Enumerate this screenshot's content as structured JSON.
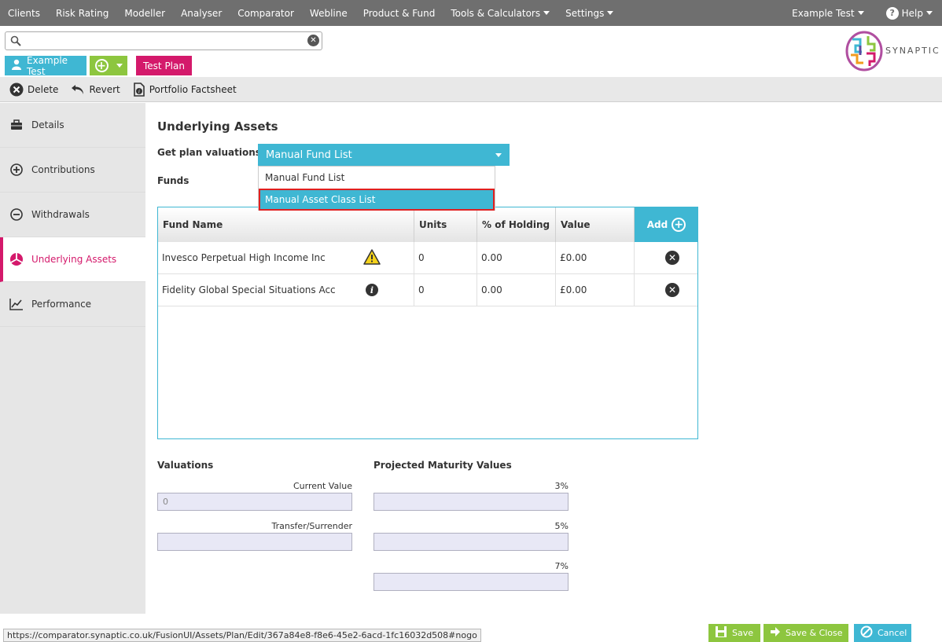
{
  "topnav": {
    "items": [
      "Clients",
      "Risk Rating",
      "Modeller",
      "Analyser",
      "Comparator",
      "Webline",
      "Product & Fund",
      "Tools & Calculators",
      "Settings"
    ],
    "user": "Example Test",
    "help": "Help"
  },
  "search": {
    "value": "",
    "placeholder": ""
  },
  "logo": {
    "text": "SYNAPTIC"
  },
  "client": {
    "name": "Example Test",
    "plan": "Test Plan"
  },
  "toolbar": {
    "delete": "Delete",
    "revert": "Revert",
    "factsheet": "Portfolio Factsheet"
  },
  "sidebar": {
    "items": [
      {
        "label": "Details",
        "icon": "briefcase-icon"
      },
      {
        "label": "Contributions",
        "icon": "plus-circle-icon"
      },
      {
        "label": "Withdrawals",
        "icon": "minus-circle-icon"
      },
      {
        "label": "Underlying Assets",
        "icon": "pie-chart-icon"
      },
      {
        "label": "Performance",
        "icon": "line-chart-icon"
      }
    ],
    "active": "Underlying Assets"
  },
  "main": {
    "title": "Underlying Assets",
    "get_plan_label": "Get plan valuations:",
    "select_value": "Manual Fund List",
    "options": [
      "Manual Fund List",
      "Manual Asset Class List"
    ],
    "funds_label": "Funds"
  },
  "table": {
    "headers": [
      "Fund Name",
      "Units",
      "% of Holding",
      "Value"
    ],
    "add_label": "Add",
    "rows": [
      {
        "name": "Invesco Perpetual High Income Inc",
        "units": "0",
        "holding": "0.00",
        "value": "£0.00",
        "icon": "warning-icon"
      },
      {
        "name": "Fidelity Global Special Situations Acc",
        "units": "0",
        "holding": "0.00",
        "value": "£0.00",
        "icon": "info-icon"
      }
    ]
  },
  "valuations": {
    "title": "Valuations",
    "current_value_label": "Current Value",
    "current_value": "0",
    "transfer_label": "Transfer/Surrender",
    "transfer_value": ""
  },
  "projected": {
    "title": "Projected Maturity Values",
    "rates": [
      "3%",
      "5%",
      "7%"
    ]
  },
  "status_url": "https://comparator.synaptic.co.uk/FusionUI/Assets/Plan/Edit/367a84e8-f8e6-45e2-6acd-1fc16032d508#nogo",
  "buttons": {
    "save": "Save",
    "save_close": "Save & Close",
    "cancel": "Cancel"
  },
  "colors": {
    "accent_blue": "#3fb7d3",
    "accent_magenta": "#d4196b",
    "accent_green": "#8dc63f",
    "nav_grey": "#6f6f6f"
  }
}
